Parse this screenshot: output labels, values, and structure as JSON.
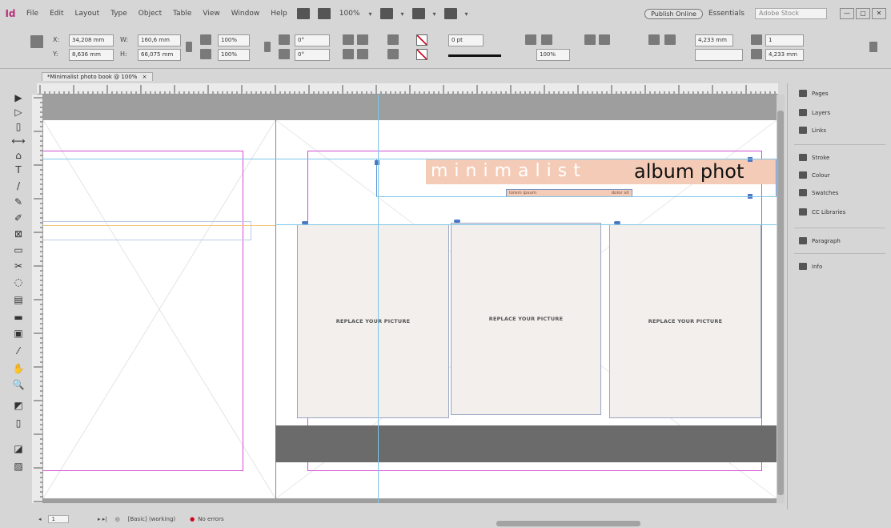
{
  "app": {
    "logo": "Id"
  },
  "menubar": {
    "items": [
      "File",
      "Edit",
      "Layout",
      "Type",
      "Object",
      "Table",
      "View",
      "Window",
      "Help"
    ],
    "zoom": "100%",
    "publish_online": "Publish Online",
    "workspace": "Essentials",
    "search_placeholder": "Adobe Stock",
    "window_buttons": [
      "—",
      "▢",
      "✕"
    ]
  },
  "control_panel": {
    "x_label": "X:",
    "y_label": "Y:",
    "w_label": "W:",
    "h_label": "H:",
    "x_value": "34,208 mm",
    "y_value": "8,636 mm",
    "w_value": "160,6 mm",
    "h_value": "66,075 mm",
    "scale_x": "100%",
    "scale_y": "100%",
    "angle": "0°",
    "shear": "0°",
    "stroke_weight": "0 pt",
    "opacity": "100%",
    "ref_x": "4,233 mm",
    "ref_y": "4,233 mm",
    "columns": "1"
  },
  "document": {
    "tab_label": "*Minimalist photo book @ 100%",
    "tab_close": "×"
  },
  "tools": [
    "▶",
    "▷",
    "▯",
    "⟷",
    "⌂",
    "T",
    "/",
    "✎",
    "✐",
    "⊠",
    "▭",
    "✂",
    "◌",
    "▤",
    "▬",
    "▣",
    "⁄",
    "✋",
    "🔍",
    "◩",
    "▯",
    "◪",
    "▨"
  ],
  "design": {
    "title_word1": "minimalist",
    "title_word2": "album phot",
    "sub_left": "lorem ipsum",
    "sub_right": "dolor sit",
    "photo_labels": [
      "REPLACE YOUR PICTURE",
      "REPLACE YOUR PICTURE",
      "REPLACE YOUR PICTURE"
    ]
  },
  "statusbar": {
    "page": "1",
    "master": "[Basic] (working)",
    "errors": "No errors"
  },
  "panel": {
    "items": [
      "Pages",
      "Layers",
      "Links",
      "Stroke",
      "Colour",
      "Swatches",
      "CC Libraries",
      "Paragraph",
      "Info"
    ]
  },
  "colors": {
    "accent_peach": "#f4cbb6",
    "frame_magenta": "#d44bd4",
    "guide_cyan": "#7ec6e8",
    "grey_strip": "#6b6b6b",
    "pasteboard": "#9e9e9e"
  }
}
